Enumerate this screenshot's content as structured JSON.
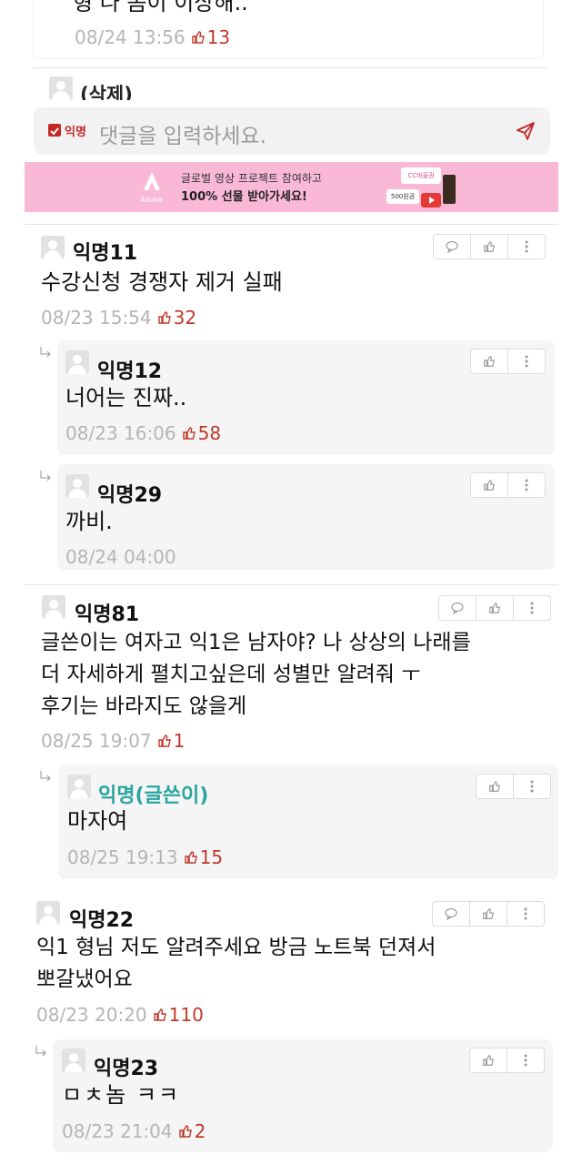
{
  "top_partial": {
    "text": "형 나 좀이 이상해..",
    "date": "08/24 13:56",
    "likes": "13"
  },
  "deleted": {
    "text": "(삭제)"
  },
  "comment_input": {
    "anon_label": "익명",
    "placeholder": "댓글을 입력하세요."
  },
  "ad": {
    "brand": "Adobe",
    "line1": "글로벌 영상 프로젝트 참여하고",
    "line2_a": "100% 선물",
    "line2_b": " 받아가세요!",
    "card1": "CC바울권",
    "card2": "500원권",
    "bg": "#f9b8d6"
  },
  "comments": [
    {
      "nick": "익명11",
      "text": "수강신청 경쟁자 제거 실패",
      "date": "08/23 15:54",
      "likes": "32"
    },
    {
      "nick": "익명12",
      "text": "너어는 진짜..",
      "date": "08/23 16:06",
      "likes": "58"
    },
    {
      "nick": "익명29",
      "text": "까비.",
      "date": "08/24 04:00",
      "likes": ""
    },
    {
      "nick": "익명81",
      "text_lines": [
        "글쓴이는 여자고 익1은 남자야? 나 상상의 나래를",
        "더 자세하게 펼치고싶은데 성별만 알려줘 ㅜ",
        "후기는 바라지도 않을게"
      ],
      "date": "08/25 19:07",
      "likes": "1"
    },
    {
      "nick": "익명(글쓴이)",
      "text": "마자여",
      "date": "08/25 19:13",
      "likes": "15"
    },
    {
      "nick": "익명22",
      "text_lines": [
        "익1 형님 저도 알려주세요 방금 노트북 던져서",
        "뽀갈냈어요"
      ],
      "date": "08/23 20:20",
      "likes": "110"
    },
    {
      "nick": "익명23",
      "text": "ㅁㅊ놈 ㅋㅋ",
      "date": "08/23 21:04",
      "likes": "2"
    }
  ],
  "colors": {
    "like": "#c0392b",
    "author": "#2aa5a0",
    "anon_check": "#c62828"
  }
}
